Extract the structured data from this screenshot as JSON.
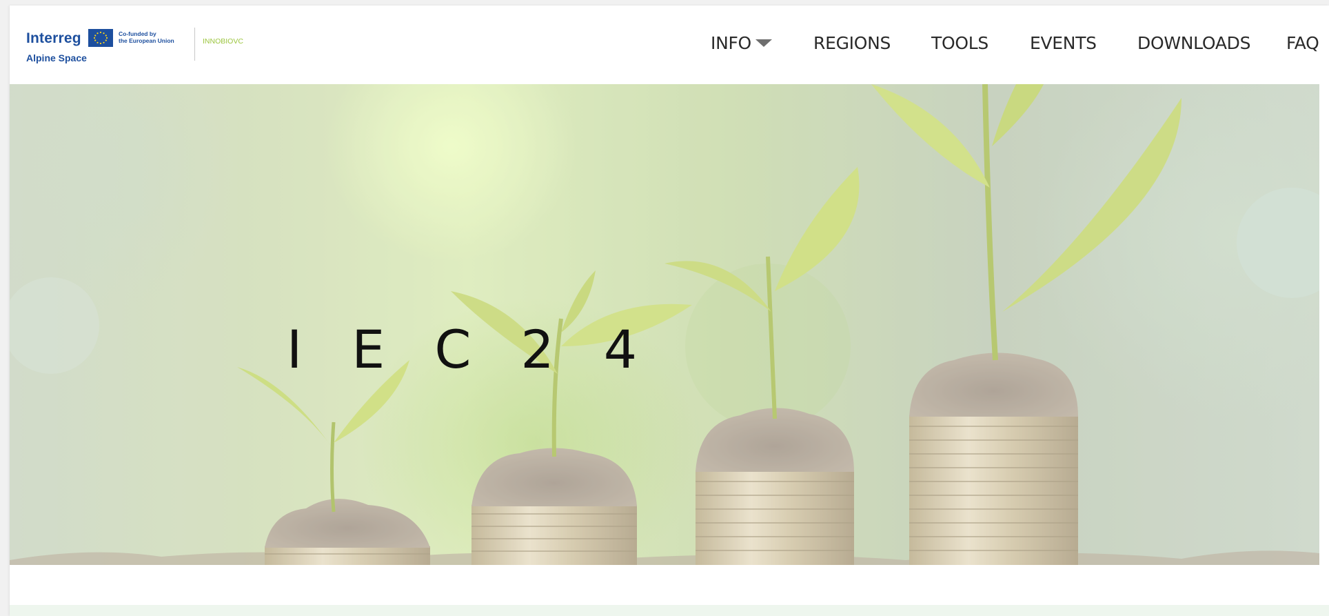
{
  "logo": {
    "brand": "Interreg",
    "region": "Alpine Space",
    "cofund_line1": "Co-funded by",
    "cofund_line2": "the European Union",
    "project": "INNOBIOVC"
  },
  "nav": {
    "items": [
      {
        "label": "INFO"
      },
      {
        "label": "REGIONS"
      },
      {
        "label": "TOOLS"
      },
      {
        "label": "EVENTS"
      },
      {
        "label": "DOWNLOADS"
      },
      {
        "label": "FAQ"
      }
    ]
  },
  "hero": {
    "title": "IEC24"
  },
  "colors": {
    "brand_blue": "#1d4f9e",
    "project_green": "#9bc53d",
    "nav_text": "#2a2a2a",
    "hero_title": "#111111"
  },
  "icons": {
    "dropdown": "caret-down-icon",
    "eu_flag": "eu-flag-icon"
  }
}
